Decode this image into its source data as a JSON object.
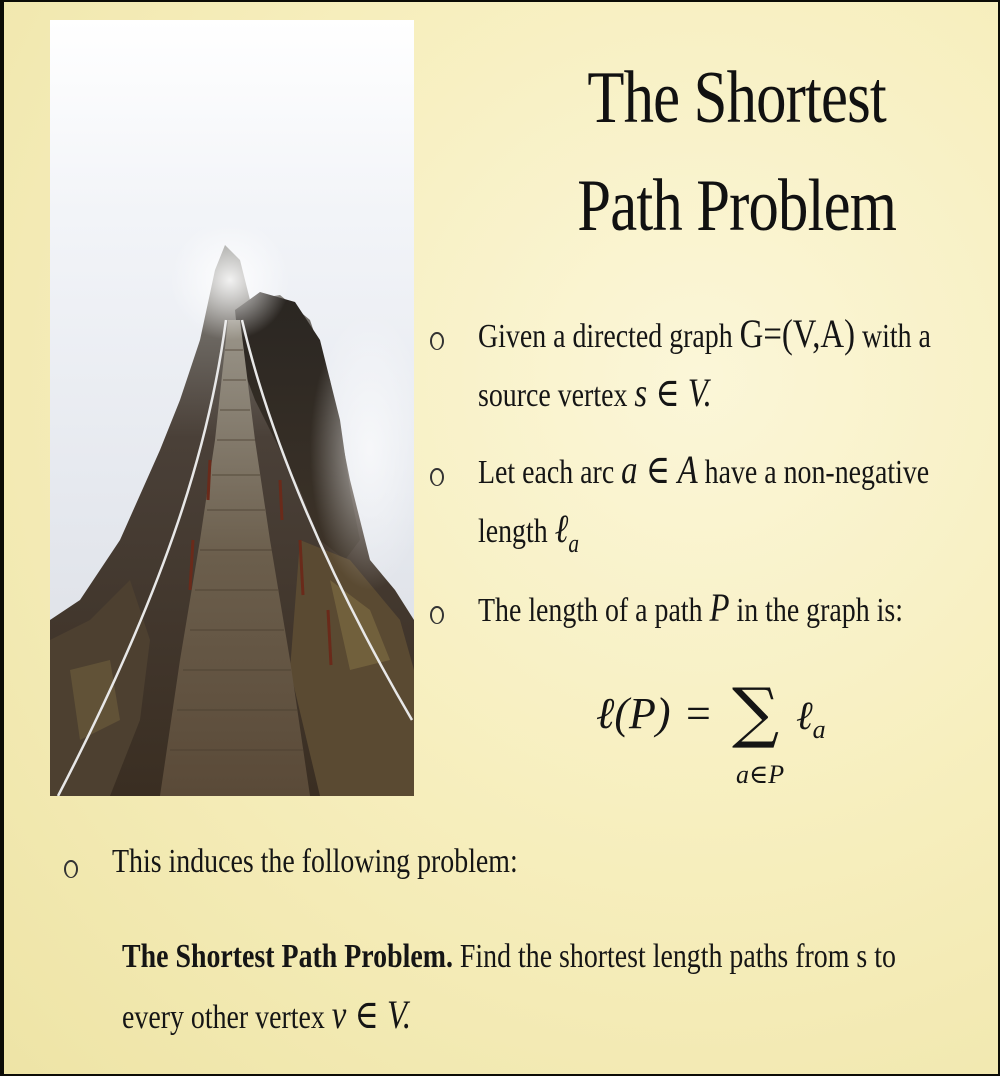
{
  "title": {
    "line1": "The Shortest",
    "line2": "Path Problem"
  },
  "bullets": [
    {
      "pre": "Given a directed graph ",
      "math": "G=(V,A)",
      "post": " with a",
      "line2_pre": "source vertex ",
      "line2_math": "s ∈ V."
    },
    {
      "pre": "Let each arc ",
      "math": "a ∈ A",
      "post": " have a non-negative",
      "line2_pre": "length ",
      "line2_math": "ℓ",
      "line2_sub": "a"
    },
    {
      "pre": "The length of a path ",
      "math": "P",
      "post": " in the graph is:"
    }
  ],
  "formula": {
    "lhs": "ℓ(P)",
    "equals": "=",
    "sum": "∑",
    "term": "ℓ",
    "term_sub": "a",
    "under": "a∈P"
  },
  "bullet4": "This induces the following problem:",
  "definition": {
    "bold": "The Shortest Path Problem.",
    "text": " Find the shortest length paths from s to",
    "line2": "every other vertex ",
    "line2_math": "v ∈ V."
  },
  "colors": {
    "background": "#f7efbf",
    "text": "#151515"
  }
}
